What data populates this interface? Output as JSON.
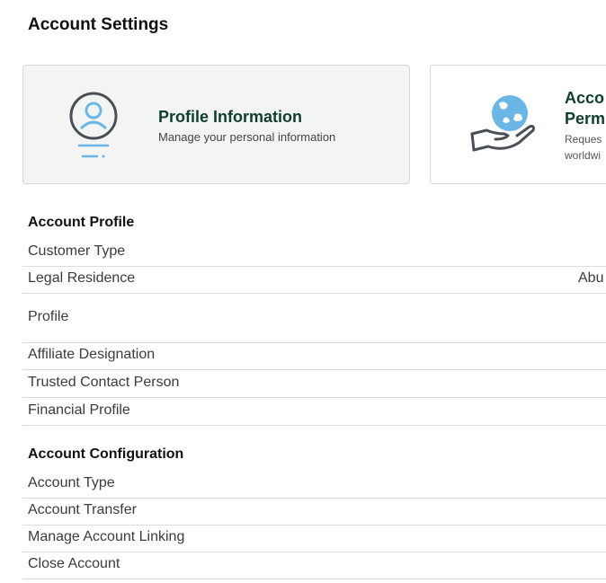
{
  "page": {
    "title": "Account Settings"
  },
  "cards": [
    {
      "title": "Profile Information",
      "description": "Manage your personal information",
      "icon": "profile-icon"
    },
    {
      "title": "Acco\nPerm",
      "description": "Reques\nworldwi",
      "icon": "globe-hand-icon"
    }
  ],
  "account_profile": {
    "heading": "Account Profile",
    "items": [
      {
        "label": "Customer Type",
        "value": ""
      },
      {
        "label": "Legal Residence",
        "value": "Abu"
      },
      {
        "label": "Profile",
        "value": ""
      },
      {
        "label": "Affiliate Designation",
        "value": ""
      },
      {
        "label": "Trusted Contact Person",
        "value": ""
      },
      {
        "label": "Financial Profile",
        "value": ""
      }
    ]
  },
  "account_configuration": {
    "heading": "Account Configuration",
    "items": [
      {
        "label": "Account Type"
      },
      {
        "label": "Account Transfer"
      },
      {
        "label": "Manage Account Linking"
      },
      {
        "label": "Close Account"
      }
    ]
  },
  "colors": {
    "card_title": "#0f3d2e",
    "icon_blue": "#6ab7e6",
    "icon_gray": "#4a4f55"
  }
}
